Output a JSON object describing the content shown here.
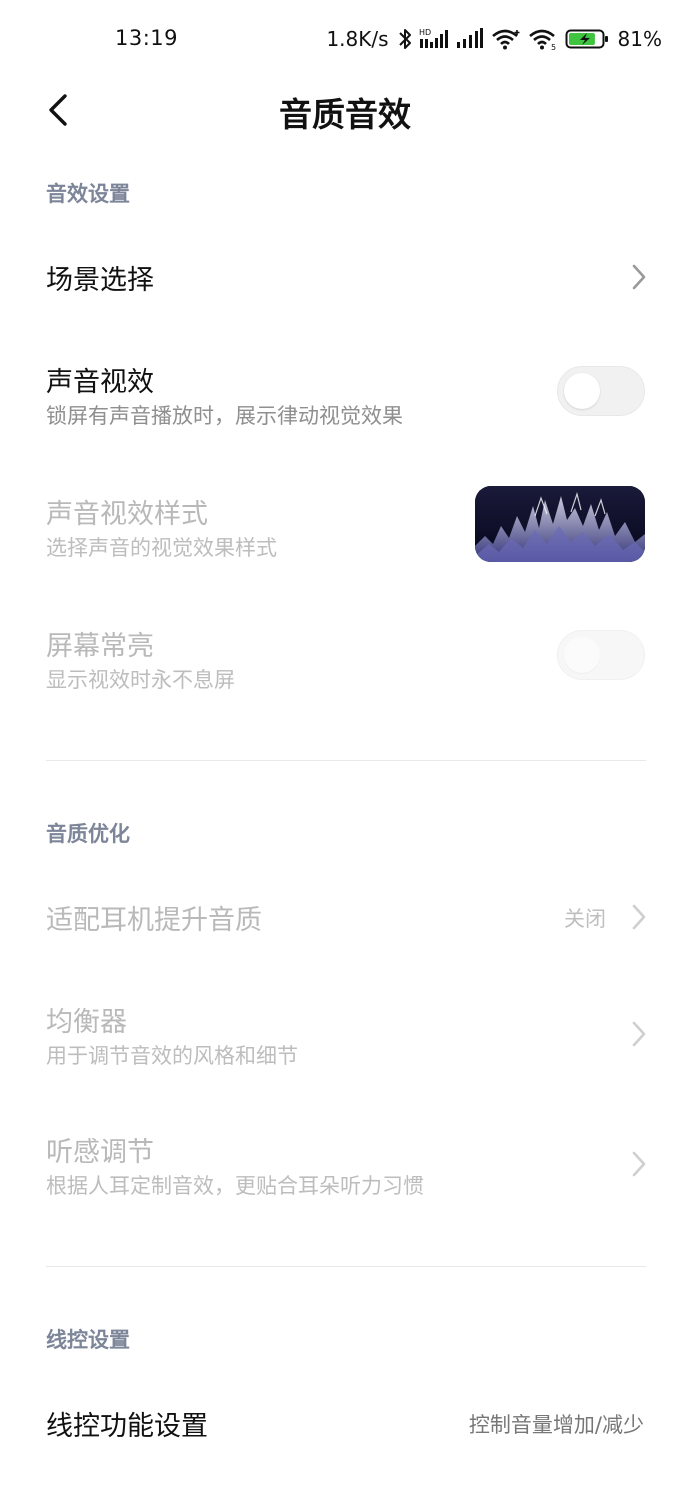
{
  "status_bar": {
    "time": "13:19",
    "net_speed": "1.8K/s",
    "battery_pct": "81%",
    "icons": [
      "bluetooth-icon",
      "hd-signal-icon",
      "signal-icon",
      "wifi-icon",
      "wifi-5-icon",
      "battery-charging-icon"
    ],
    "wifi_badge": "5",
    "hd_badge": "HD",
    "battery_level": 0.81,
    "battery_color": "#3ec43e"
  },
  "header": {
    "title": "音质音效",
    "back_icon": "chevron-left-icon"
  },
  "colors": {
    "section_header": "#7d8599",
    "title_text": "#111111",
    "disabled_text": "#b9b9b9",
    "sub_text": "#8f8f8f"
  },
  "sections": {
    "sound_effects": {
      "label": "音效设置",
      "scene_select": {
        "title": "场景选择"
      },
      "sound_visual": {
        "title": "声音视效",
        "subtitle": "锁屏有声音播放时，展示律动视觉效果",
        "enabled": false
      },
      "visual_style": {
        "title": "声音视效样式",
        "subtitle": "选择声音的视觉效果样式"
      },
      "screen_on": {
        "title": "屏幕常亮",
        "subtitle": "显示视效时永不息屏",
        "enabled": false
      }
    },
    "quality": {
      "label": "音质优化",
      "headphone_adapt": {
        "title": "适配耳机提升音质",
        "value": "关闭"
      },
      "equalizer": {
        "title": "均衡器",
        "subtitle": "用于调节音效的风格和细节"
      },
      "hearing": {
        "title": "听感调节",
        "subtitle": "根据人耳定制音效，更贴合耳朵听力习惯"
      }
    },
    "wire_control": {
      "label": "线控设置",
      "function": {
        "title": "线控功能设置",
        "value": "控制音量增加/减少"
      }
    }
  }
}
